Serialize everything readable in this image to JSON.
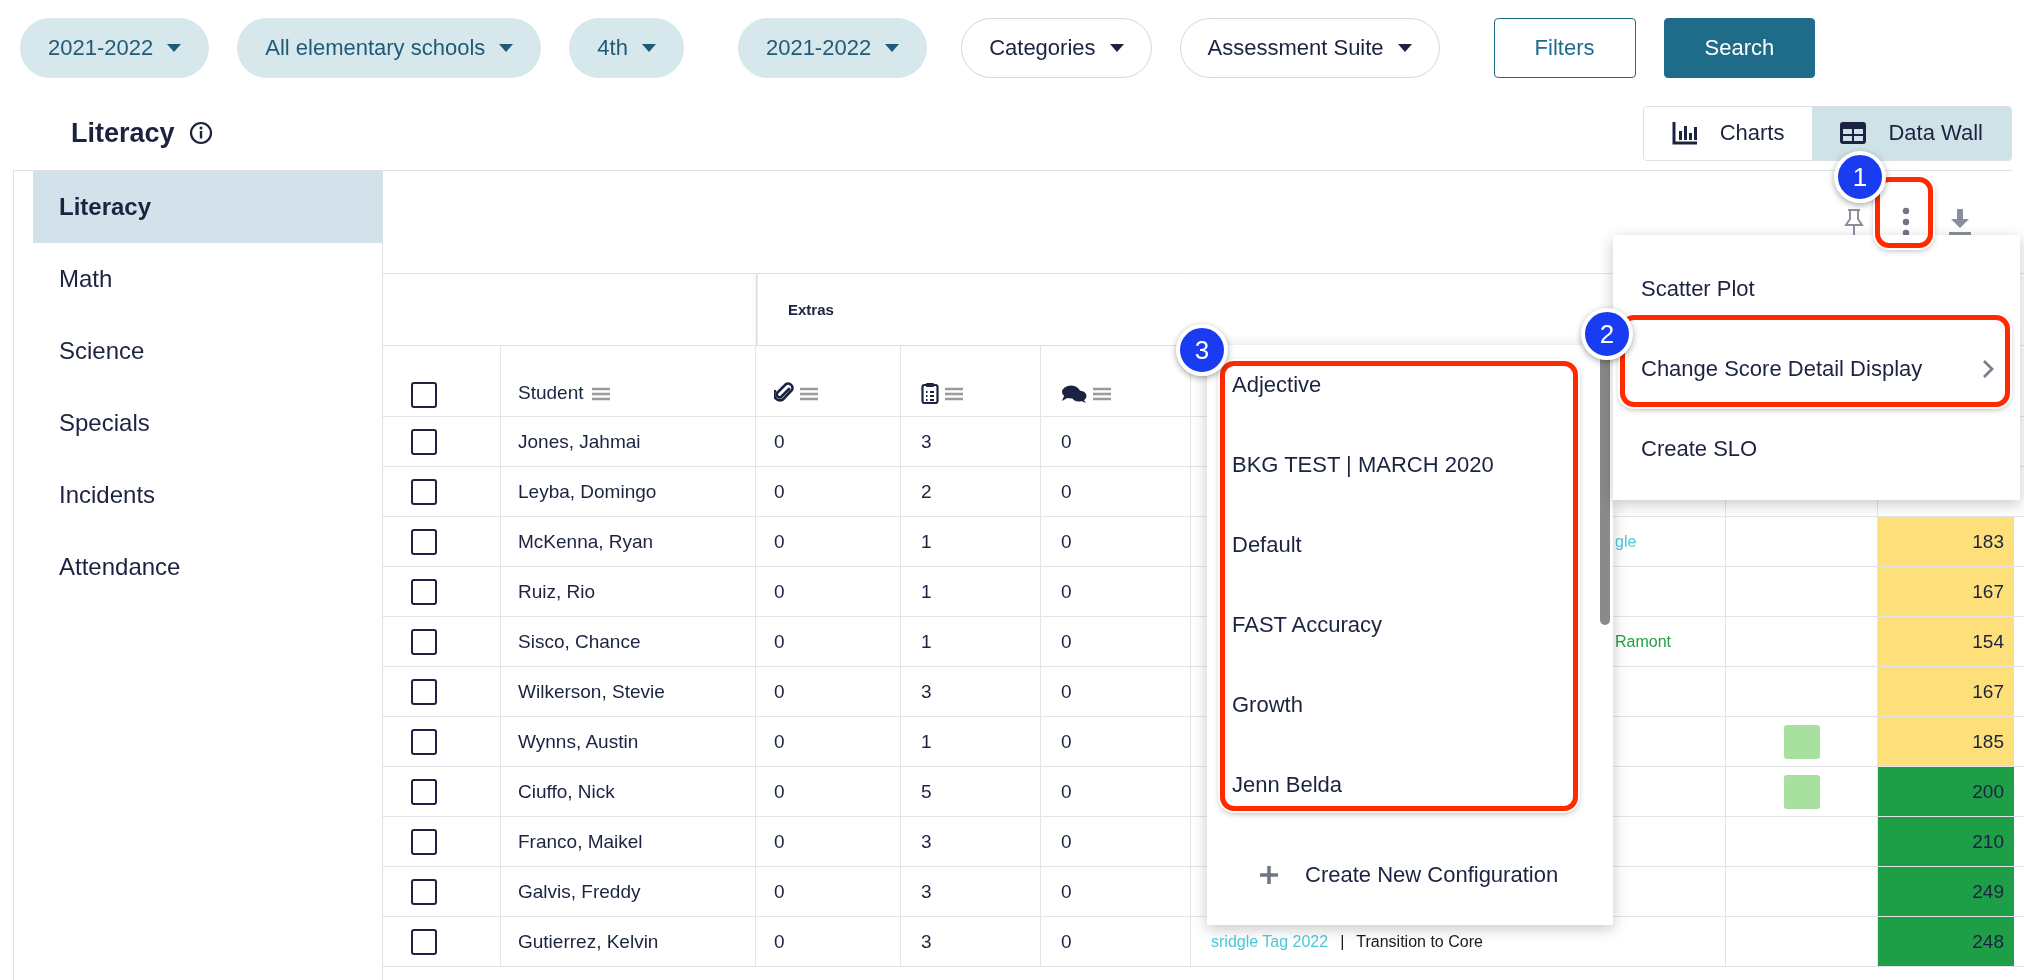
{
  "filters": [
    {
      "label": "2021-2022",
      "kind": "filled"
    },
    {
      "label": "All elementary schools",
      "kind": "filled"
    },
    {
      "label": "4th",
      "kind": "filled"
    },
    {
      "label": "2021-2022",
      "kind": "filled"
    },
    {
      "label": "Categories",
      "kind": "outline"
    },
    {
      "label": "Assessment Suite",
      "kind": "outline"
    }
  ],
  "buttons": [
    {
      "label": "Filters",
      "kind": "outline"
    },
    {
      "label": "Search",
      "kind": "primary"
    }
  ],
  "title": "Literacy",
  "view_tabs": [
    {
      "label": "Charts",
      "kind": "chart",
      "selected": false
    },
    {
      "label": "Data Wall",
      "kind": "grid",
      "selected": true
    }
  ],
  "sidebar": {
    "items": [
      {
        "label": "Literacy",
        "selected": true
      },
      {
        "label": "Math",
        "selected": false
      },
      {
        "label": "Science",
        "selected": false
      },
      {
        "label": "Specials",
        "selected": false
      },
      {
        "label": "Incidents",
        "selected": false
      },
      {
        "label": "Attendance",
        "selected": false
      }
    ]
  },
  "table": {
    "group_header": "Extras",
    "student_header": "Student",
    "select_all_checked": false,
    "rows": [
      {
        "name": "Jones, Jahmai",
        "checked": false,
        "attachments": "0",
        "forms": "3",
        "comments": "0"
      },
      {
        "name": "Leyba, Domingo",
        "checked": false,
        "attachments": "0",
        "forms": "2",
        "comments": "0"
      },
      {
        "name": "McKenna, Ryan",
        "checked": false,
        "attachments": "0",
        "forms": "1",
        "comments": "0",
        "tag_clipped": true,
        "tags": [
          {
            "text": "gle",
            "kind": "tag",
            "color": "#4cc9d8"
          }
        ],
        "score": "183",
        "color": "#fde07a"
      },
      {
        "name": "Ruiz, Rio",
        "checked": false,
        "attachments": "0",
        "forms": "1",
        "comments": "0",
        "score": "167",
        "color": "#fde07a"
      },
      {
        "name": "Sisco, Chance",
        "checked": false,
        "attachments": "0",
        "forms": "1",
        "comments": "0",
        "tag_clipped": true,
        "tags": [
          {
            "text": "Ramont",
            "kind": "tag",
            "color": "#22a045"
          }
        ],
        "score": "154",
        "color": "#fde07a"
      },
      {
        "name": "Wilkerson, Stevie",
        "checked": false,
        "attachments": "0",
        "forms": "3",
        "comments": "0",
        "score": "167",
        "color": "#fde07a"
      },
      {
        "name": "Wynns, Austin",
        "checked": false,
        "attachments": "0",
        "forms": "1",
        "comments": "0",
        "marker": true,
        "score": "185",
        "color": "#fde07a"
      },
      {
        "name": "Ciuffo, Nick",
        "checked": false,
        "attachments": "0",
        "forms": "5",
        "comments": "0",
        "marker": true,
        "score": "200",
        "color": "#1f9e48"
      },
      {
        "name": "Franco, Maikel",
        "checked": false,
        "attachments": "0",
        "forms": "3",
        "comments": "0",
        "score": "210",
        "color": "#1f9e48"
      },
      {
        "name": "Galvis, Freddy",
        "checked": false,
        "attachments": "0",
        "forms": "3",
        "comments": "0",
        "score": "249",
        "color": "#1f9e48"
      },
      {
        "name": "Gutierrez, Kelvin",
        "checked": false,
        "attachments": "0",
        "forms": "3",
        "comments": "0",
        "tags": [
          {
            "text": "sridgle Tag 2022",
            "kind": "tag",
            "color": "#4cc9d8"
          },
          {
            "text": "|",
            "kind": "separator",
            "color": "#1b1b1b"
          },
          {
            "text": "Transition to Core",
            "kind": "text",
            "color": "#1b1b1b"
          }
        ],
        "score": "248",
        "color": "#1f9e48"
      }
    ]
  },
  "actions_menu": {
    "items": [
      {
        "label": "Scatter Plot",
        "kind": "item"
      },
      {
        "label": "Change Score Detail Display",
        "kind": "submenu"
      },
      {
        "label": "Create SLO",
        "kind": "item"
      }
    ]
  },
  "configurations_menu": {
    "items": [
      "Adjective",
      "BKG TEST | MARCH 2020",
      "Default",
      "FAST Accuracy",
      "Growth",
      "Jenn Belda"
    ],
    "create_label": "Create New Configuration"
  },
  "annotations": [
    {
      "number": "1"
    },
    {
      "number": "2"
    },
    {
      "number": "3"
    }
  ]
}
